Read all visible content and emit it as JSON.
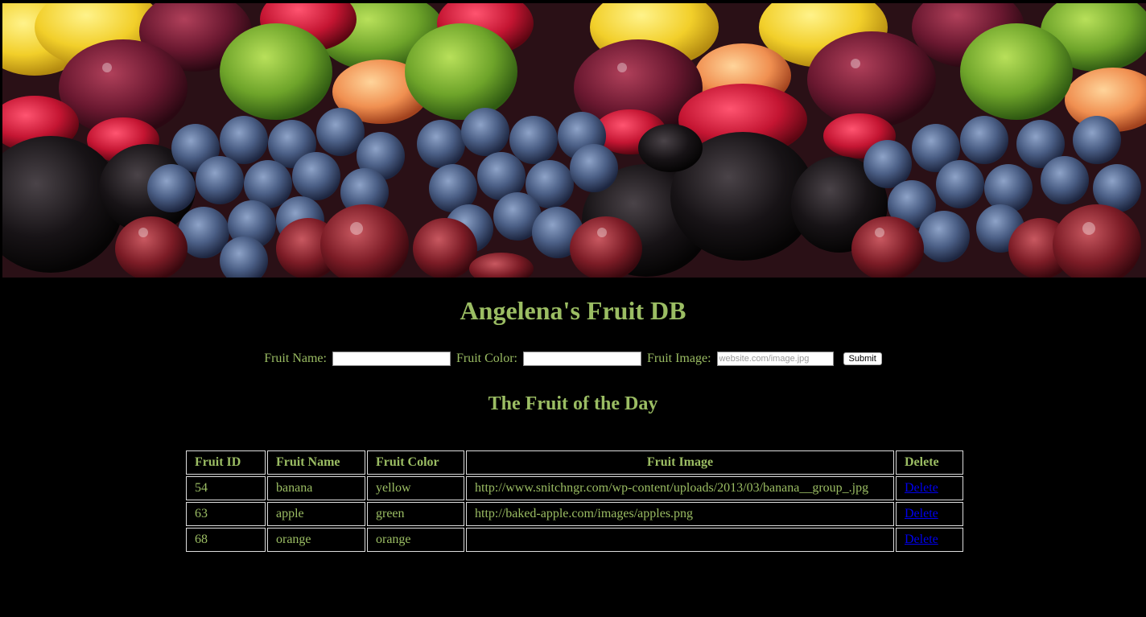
{
  "header": {
    "title": "Angelena's Fruit DB"
  },
  "form": {
    "name_label": "Fruit Name:",
    "name_value": "",
    "color_label": "Fruit Color:",
    "color_value": "",
    "image_label": "Fruit Image:",
    "image_placeholder": "website.com/image.jpg",
    "submit_label": "Submit"
  },
  "section": {
    "title": "The Fruit of the Day"
  },
  "table": {
    "headers": {
      "id": "Fruit ID",
      "name": "Fruit Name",
      "color": "Fruit Color",
      "image": "Fruit Image",
      "delete": "Delete"
    },
    "rows": [
      {
        "id": "54",
        "name": "banana",
        "color": "yellow",
        "image": "http://www.snitchngr.com/wp-content/uploads/2013/03/banana__group_.jpg",
        "delete": "Delete"
      },
      {
        "id": "63",
        "name": "apple",
        "color": "green",
        "image": "http://baked-apple.com/images/apples.png",
        "delete": "Delete"
      },
      {
        "id": "68",
        "name": "orange",
        "color": "orange",
        "image": "",
        "delete": "Delete"
      }
    ]
  },
  "theme": {
    "background": "#000000",
    "text_color": "#9bbd63",
    "link_color": "#0000ee"
  },
  "banner": {
    "icon": "fruit-banner-image"
  }
}
